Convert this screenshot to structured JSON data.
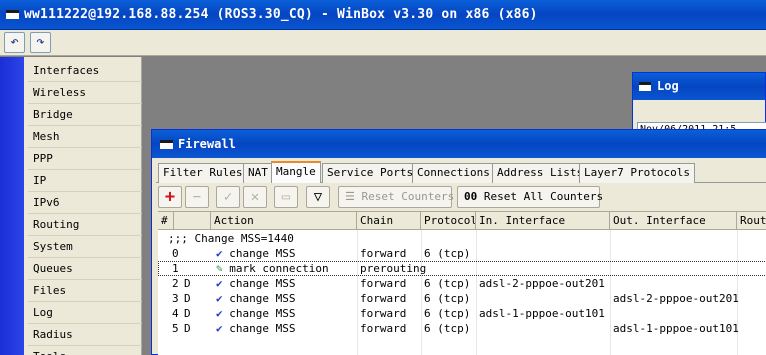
{
  "window": {
    "title": "ww111222@192.168.88.254 (ROS3.30_CQ) - WinBox v3.30 on x86 (x86)"
  },
  "toolbar": {
    "undo_icon": "undo-icon",
    "redo_icon": "redo-icon"
  },
  "sidebar": {
    "items": [
      {
        "label": "Interfaces",
        "has_submenu": false
      },
      {
        "label": "Wireless",
        "has_submenu": false
      },
      {
        "label": "Bridge",
        "has_submenu": false
      },
      {
        "label": "Mesh",
        "has_submenu": false
      },
      {
        "label": "PPP",
        "has_submenu": false
      },
      {
        "label": "IP",
        "has_submenu": true
      },
      {
        "label": "IPv6",
        "has_submenu": true
      },
      {
        "label": "Routing",
        "has_submenu": true
      },
      {
        "label": "System",
        "has_submenu": true
      },
      {
        "label": "Queues",
        "has_submenu": false
      },
      {
        "label": "Files",
        "has_submenu": false
      },
      {
        "label": "Log",
        "has_submenu": false
      },
      {
        "label": "Radius",
        "has_submenu": false
      },
      {
        "label": "Tools",
        "has_submenu": true
      }
    ]
  },
  "log_window": {
    "title": "Log",
    "first_row": "Nov/06/2011 21:5"
  },
  "firewall": {
    "title": "Firewall",
    "tabs": [
      "Filter Rules",
      "NAT",
      "Mangle",
      "Service Ports",
      "Connections",
      "Address Lists",
      "Layer7 Protocols"
    ],
    "active_tab": "Mangle",
    "buttons": {
      "reset_counters": "Reset Counters",
      "reset_all_counters": "Reset All Counters",
      "reset_all_prefix": "00"
    },
    "columns": [
      "#",
      "Action",
      "Chain",
      "Protocol",
      "In. Interface",
      "Out. Interface",
      "Routi"
    ],
    "comment": ";;; Change MSS=1440",
    "rows": [
      {
        "num": "0",
        "flag": "",
        "icon": "check",
        "action": "change MSS",
        "chain": "forward",
        "protocol": "6 (tcp)",
        "in_interface": "",
        "out_interface": ""
      },
      {
        "num": "1",
        "flag": "",
        "icon": "pencil",
        "action": "mark connection",
        "chain": "prerouting",
        "protocol": "",
        "in_interface": "",
        "out_interface": ""
      },
      {
        "num": "2",
        "flag": "D",
        "icon": "check",
        "action": "change MSS",
        "chain": "forward",
        "protocol": "6 (tcp)",
        "in_interface": "adsl-2-pppoe-out201",
        "out_interface": ""
      },
      {
        "num": "3",
        "flag": "D",
        "icon": "check",
        "action": "change MSS",
        "chain": "forward",
        "protocol": "6 (tcp)",
        "in_interface": "",
        "out_interface": "adsl-2-pppoe-out201"
      },
      {
        "num": "4",
        "flag": "D",
        "icon": "check",
        "action": "change MSS",
        "chain": "forward",
        "protocol": "6 (tcp)",
        "in_interface": "adsl-1-pppoe-out101",
        "out_interface": ""
      },
      {
        "num": "5",
        "flag": "D",
        "icon": "check",
        "action": "change MSS",
        "chain": "forward",
        "protocol": "6 (tcp)",
        "in_interface": "",
        "out_interface": "adsl-1-pppoe-out101"
      }
    ]
  }
}
